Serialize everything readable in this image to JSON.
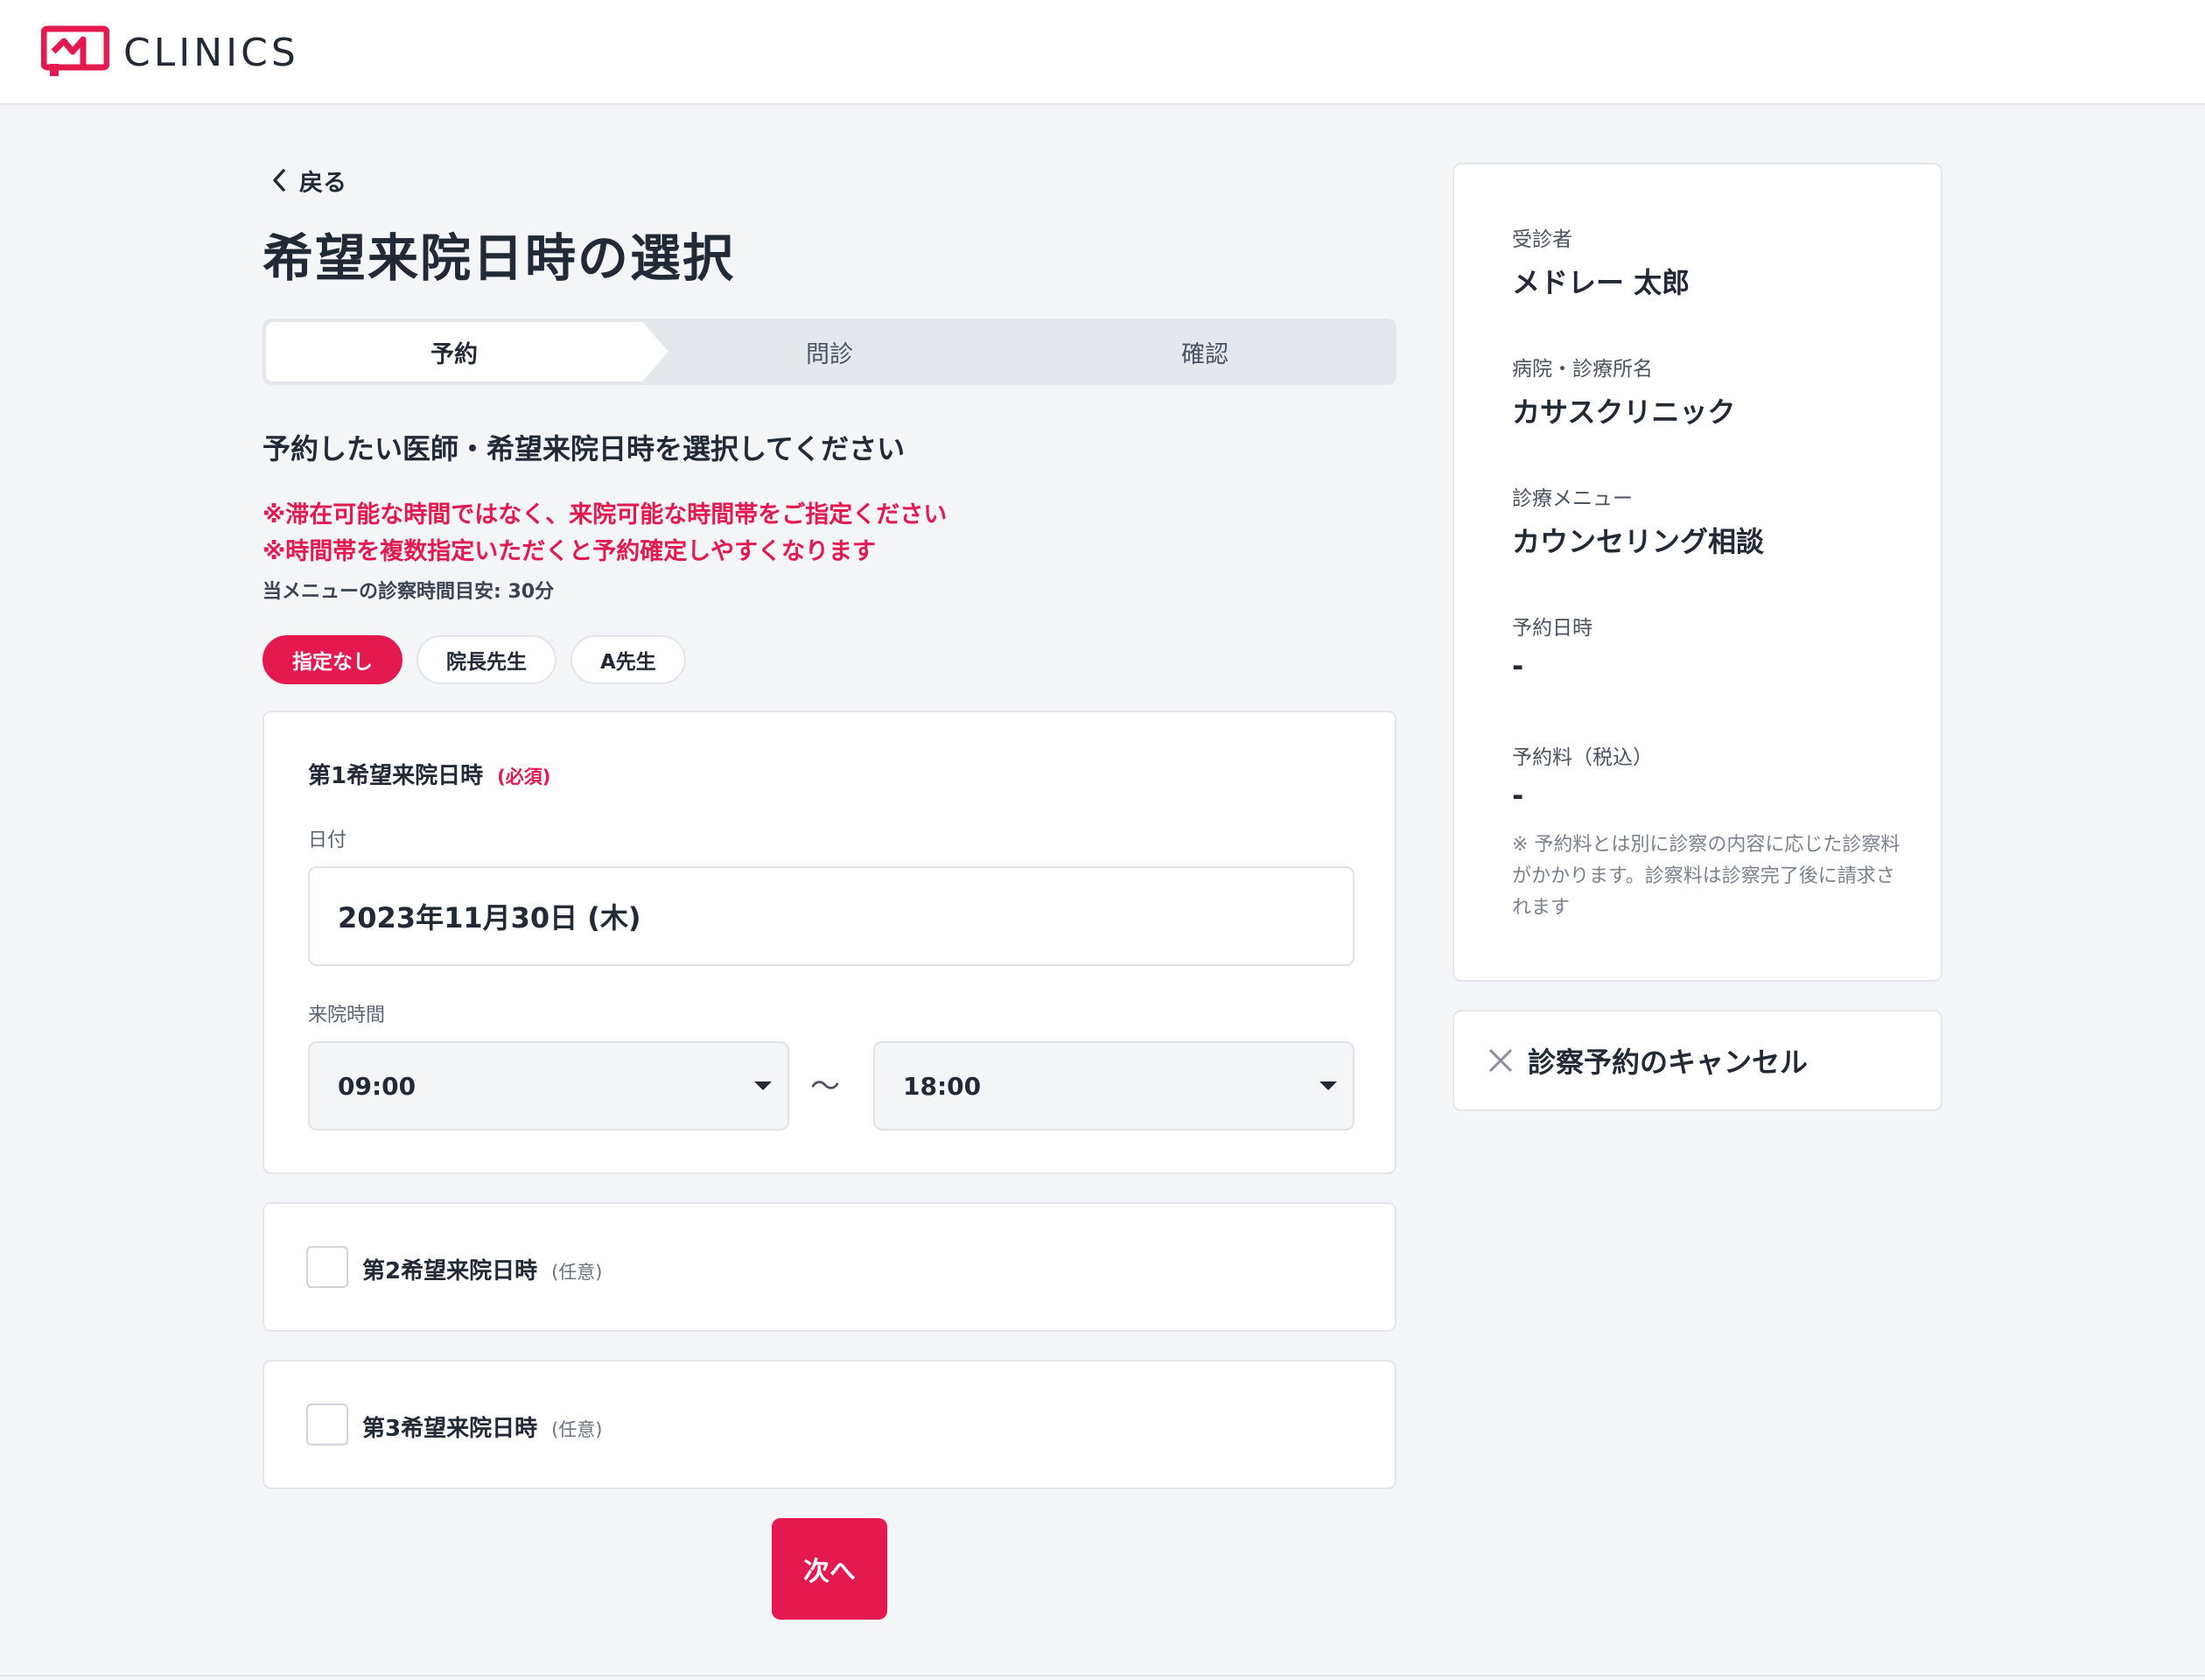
{
  "brand": {
    "name": "CLINICS",
    "accent_color": "#e3194f"
  },
  "nav": {
    "back_label": "戻る"
  },
  "page": {
    "title": "希望来院日時の選択"
  },
  "steps": [
    {
      "label": "予約",
      "active": true
    },
    {
      "label": "問診",
      "active": false
    },
    {
      "label": "確認",
      "active": false
    }
  ],
  "form": {
    "instruction": "予約したい医師・希望来院日時を選択してください",
    "notices": [
      "※滞在可能な時間ではなく、来院可能な時間帯をご指定ください",
      "※時間帯を複数指定いただくと予約確定しやすくなります"
    ],
    "duration_note": "当メニューの診察時間目安: 30分",
    "doctors": [
      {
        "label": "指定なし",
        "selected": true
      },
      {
        "label": "院長先生",
        "selected": false
      },
      {
        "label": "A先生",
        "selected": false
      }
    ],
    "first_choice": {
      "heading": "第1希望来院日時",
      "required_label": "(必須)",
      "date_label": "日付",
      "date_value": "2023年11月30日 (木)",
      "time_label": "来院時間",
      "time_from": "09:00",
      "time_separator": "〜",
      "time_to": "18:00"
    },
    "second_choice": {
      "heading": "第2希望来院日時",
      "optional_label": "(任意)",
      "checked": false
    },
    "third_choice": {
      "heading": "第3希望来院日時",
      "optional_label": "(任意)",
      "checked": false
    },
    "next_label": "次へ"
  },
  "summary": {
    "patient": {
      "label": "受診者",
      "value": "メドレー 太郎"
    },
    "clinic": {
      "label": "病院・診療所名",
      "value": "カサスクリニック"
    },
    "menu": {
      "label": "診療メニュー",
      "value": "カウンセリング相談"
    },
    "datetime": {
      "label": "予約日時",
      "value": "-"
    },
    "fee": {
      "label": "予約料（税込）",
      "value": "-"
    },
    "fee_note": "※ 予約料とは別に診察の内容に応じた診察料がかかります。診察料は診察完了後に請求されます"
  },
  "cancel": {
    "label": "診察予約のキャンセル"
  }
}
